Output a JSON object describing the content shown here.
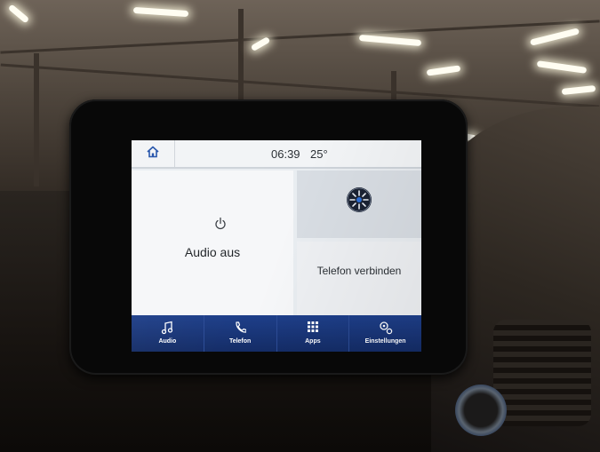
{
  "status_bar": {
    "time": "06:39",
    "temperature": "25°"
  },
  "audio_panel": {
    "label": "Audio aus",
    "icon": "power-icon"
  },
  "phone_panel": {
    "label": "Telefon verbinden",
    "icon": "sync-logo"
  },
  "nav": {
    "items": [
      {
        "label": "Audio",
        "icon": "music-note-icon"
      },
      {
        "label": "Telefon",
        "icon": "phone-icon"
      },
      {
        "label": "Apps",
        "icon": "apps-grid-icon"
      },
      {
        "label": "Einstellungen",
        "icon": "settings-icon"
      }
    ]
  },
  "colors": {
    "nav_background": "#1e3f8a",
    "screen_background": "#e9edf1",
    "accent": "#1f4fa8"
  }
}
